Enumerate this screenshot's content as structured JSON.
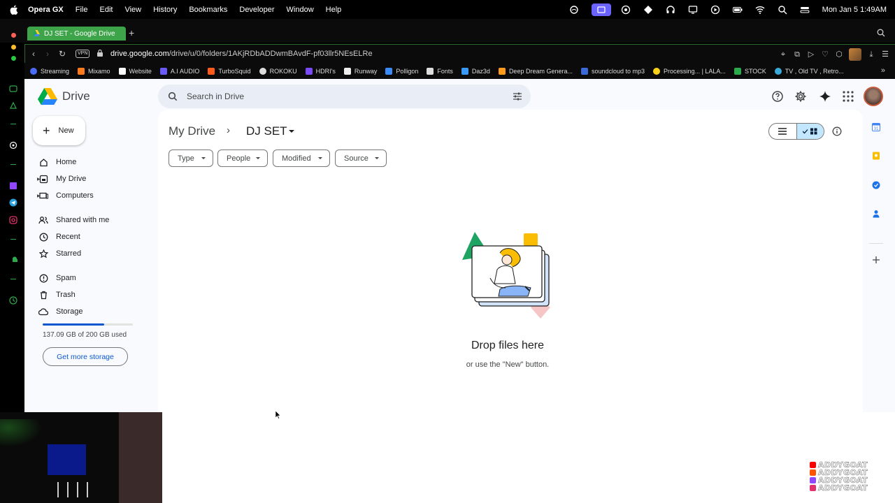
{
  "os_menubar": {
    "app_name": "Opera GX",
    "menus": [
      "File",
      "Edit",
      "View",
      "History",
      "Bookmarks",
      "Developer",
      "Window",
      "Help"
    ],
    "clock": "Mon Jan 5  1:49AM"
  },
  "browser": {
    "tab_title": "DJ SET - Google Drive",
    "vpn_label": "VPN",
    "url_host": "drive.google.com",
    "url_path": "/drive/u/0/folders/1AKjRDbADDwmBAvdF-pf03llr5NEsELRe",
    "bookmarks": [
      {
        "label": "Streaming",
        "color": "#4a6cf7"
      },
      {
        "label": "Mixamo",
        "color": "#ff7a1a"
      },
      {
        "label": "Website",
        "color": "#ffffff"
      },
      {
        "label": "A.I AUDIO",
        "color": "#6a5af9"
      },
      {
        "label": "TurboSquid",
        "color": "#ff5a1a"
      },
      {
        "label": "ROKOKU",
        "color": "#dddddd"
      },
      {
        "label": "HDRI's",
        "color": "#7a4af9"
      },
      {
        "label": "Runway",
        "color": "#eeeeee"
      },
      {
        "label": "Polligon",
        "color": "#3a8af9"
      },
      {
        "label": "Fonts",
        "color": "#dddddd"
      },
      {
        "label": "Daz3d",
        "color": "#3a9af9"
      },
      {
        "label": "Deep Dream Genera...",
        "color": "#ff9a1a"
      },
      {
        "label": "soundcloud to mp3",
        "color": "#3a6ad9"
      },
      {
        "label": "Processing... | LALA...",
        "color": "#f9d01a"
      },
      {
        "label": "STOCK",
        "color": "#2aaa4a"
      },
      {
        "label": "TV , Old TV , Retro...",
        "color": "#3aaad9"
      }
    ]
  },
  "drive": {
    "logo_text": "Drive",
    "search_placeholder": "Search in Drive",
    "new_label": "New",
    "nav": {
      "home": "Home",
      "my_drive": "My Drive",
      "computers": "Computers",
      "shared": "Shared with me",
      "recent": "Recent",
      "starred": "Starred",
      "spam": "Spam",
      "trash": "Trash",
      "storage": "Storage"
    },
    "storage_used_fraction": 0.685,
    "storage_text": "137.09 GB of 200 GB used",
    "get_storage_label": "Get more storage",
    "breadcrumb_root": "My Drive",
    "breadcrumb_sep": "›",
    "current_folder": "DJ SET",
    "filters": {
      "type": "Type",
      "people": "People",
      "modified": "Modified",
      "source": "Source"
    },
    "empty_title": "Drop files here",
    "empty_subtitle": "or use the \"New\" button."
  },
  "watermark_text": "ADDYGOAT",
  "colors": {
    "accent_blue": "#0b57d0",
    "selected_toggle": "#c2e7ff",
    "opera_green": "#3ea44a"
  }
}
